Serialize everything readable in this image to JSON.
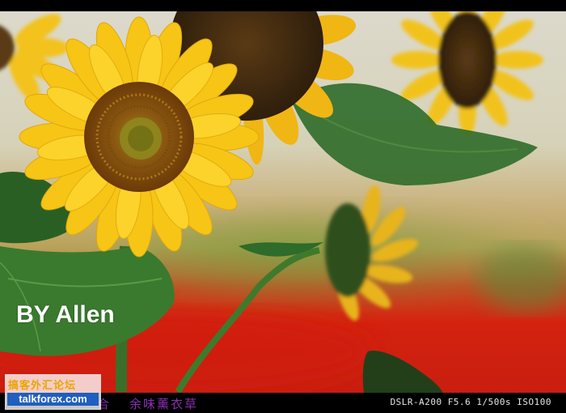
{
  "photo": {
    "caption": "BY Allen",
    "exif": "DSLR-A200  F5.6  1/500s  ISO100",
    "bottom_title": "余味薰衣草",
    "bottom_title_left": "合"
  },
  "watermark": {
    "site_name_cn": "搞客外汇论坛",
    "url": "talkforex.com"
  },
  "colors": {
    "petal": "#f7c81a",
    "center": "#8a5a12",
    "leaf": "#2f6b2a",
    "red_field": "#d42a14",
    "sky": "#d9d8c8"
  }
}
